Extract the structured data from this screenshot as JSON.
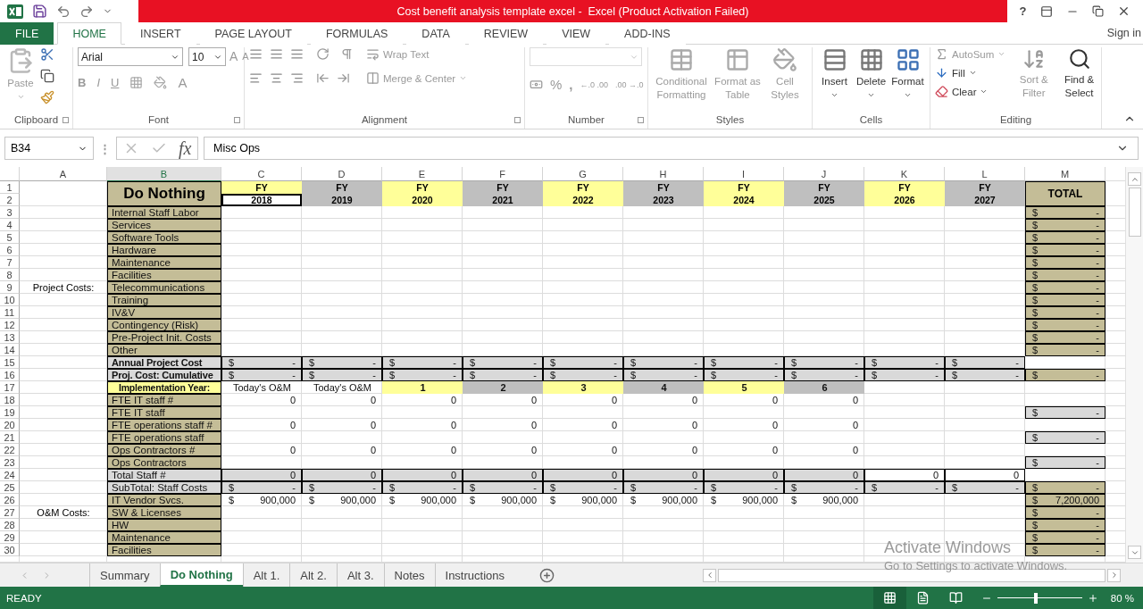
{
  "title_bar": {
    "title": "Cost benefit analysis template excel -  Excel (Product Activation Failed)",
    "help": "?"
  },
  "tabs": [
    {
      "label": "FILE",
      "kind": "file",
      "selected": false
    },
    {
      "label": "HOME",
      "kind": "tab",
      "selected": true
    },
    {
      "label": "INSERT",
      "kind": "tab",
      "selected": false
    },
    {
      "label": "PAGE LAYOUT",
      "kind": "tab",
      "selected": false
    },
    {
      "label": "FORMULAS",
      "kind": "tab",
      "selected": false
    },
    {
      "label": "DATA",
      "kind": "tab",
      "selected": false
    },
    {
      "label": "REVIEW",
      "kind": "tab",
      "selected": false
    },
    {
      "label": "VIEW",
      "kind": "tab",
      "selected": false
    },
    {
      "label": "ADD-INS",
      "kind": "tab",
      "selected": false
    }
  ],
  "sign_in": "Sign in",
  "ribbon": {
    "clipboard": {
      "label": "Clipboard",
      "paste": {
        "label": "Paste",
        "disabled": true
      }
    },
    "font": {
      "label": "Font",
      "font_name": "Arial",
      "font_size": "10",
      "grow": "A",
      "shrink": "A",
      "bold": "B",
      "italic": "I",
      "underline": "U",
      "font_color": "A"
    },
    "alignment": {
      "label": "Alignment",
      "wrap": {
        "label": "Wrap Text",
        "disabled": true
      },
      "merge": {
        "label": "Merge & Center",
        "disabled": true
      }
    },
    "number": {
      "label": "Number",
      "percent": "%",
      "comma": ",",
      "inc_decimal": "←.0 .00",
      "dec_decimal": ".00 →.0"
    },
    "styles": {
      "label": "Styles",
      "items": [
        {
          "label": "Conditional Formatting",
          "disabled": true
        },
        {
          "label": "Format as Table",
          "disabled": true
        },
        {
          "label": "Cell Styles",
          "disabled": true
        }
      ]
    },
    "cells": {
      "label": "Cells",
      "items": [
        {
          "label": "Insert",
          "disabled": false
        },
        {
          "label": "Delete",
          "disabled": false
        },
        {
          "label": "Format",
          "disabled": false
        }
      ]
    },
    "editing": {
      "label": "Editing",
      "autosum": {
        "label": "AutoSum",
        "disabled": true
      },
      "fill": {
        "label": "Fill",
        "disabled": false
      },
      "clear": {
        "label": "Clear",
        "disabled": false
      },
      "sort": {
        "label": "Sort & Filter",
        "disabled": true
      },
      "find": {
        "label": "Find & Select",
        "disabled": false
      }
    }
  },
  "formula_bar": {
    "name_box": "B34",
    "separator": "⋮",
    "fx": "fx",
    "formula": "Misc Ops"
  },
  "columns": [
    {
      "label": "A",
      "selected": false
    },
    {
      "label": "B",
      "selected": true
    },
    {
      "label": "C",
      "selected": false
    },
    {
      "label": "D",
      "selected": false
    },
    {
      "label": "E",
      "selected": false
    },
    {
      "label": "F",
      "selected": false
    },
    {
      "label": "G",
      "selected": false
    },
    {
      "label": "H",
      "selected": false
    },
    {
      "label": "I",
      "selected": false
    },
    {
      "label": "J",
      "selected": false
    },
    {
      "label": "K",
      "selected": false
    },
    {
      "label": "L",
      "selected": false
    },
    {
      "label": "M",
      "selected": false
    }
  ],
  "title_block": {
    "rows": [
      "1",
      "2"
    ],
    "title": "Do Nothing",
    "total": "TOTAL",
    "years": [
      {
        "fy": "FY",
        "year": "2018",
        "color": "#ffff99",
        "outlined": true
      },
      {
        "fy": "FY",
        "year": "2019",
        "color": "#bfbfbf",
        "outlined": false
      },
      {
        "fy": "FY",
        "year": "2020",
        "color": "#ffff99",
        "outlined": false
      },
      {
        "fy": "FY",
        "year": "2021",
        "color": "#bfbfbf",
        "outlined": false
      },
      {
        "fy": "FY",
        "year": "2022",
        "color": "#ffff99",
        "outlined": false
      },
      {
        "fy": "FY",
        "year": "2023",
        "color": "#bfbfbf",
        "outlined": false
      },
      {
        "fy": "FY",
        "year": "2024",
        "color": "#ffff99",
        "outlined": false
      },
      {
        "fy": "FY",
        "year": "2025",
        "color": "#bfbfbf",
        "outlined": false
      },
      {
        "fy": "FY",
        "year": "2026",
        "color": "#ffff99",
        "outlined": false
      },
      {
        "fy": "FY",
        "year": "2027",
        "color": "#bfbfbf",
        "outlined": false
      }
    ]
  },
  "rows": [
    {
      "n": "3",
      "b": "Internal Staff Labor",
      "kind": "tan",
      "cells": [
        null,
        null,
        null,
        null,
        null,
        null,
        null,
        null,
        null,
        null,
        {
          "kind": "tan",
          "cur": "$",
          "val": "-"
        }
      ]
    },
    {
      "n": "4",
      "b": "Services",
      "kind": "tan",
      "cells": [
        null,
        null,
        null,
        null,
        null,
        null,
        null,
        null,
        null,
        null,
        {
          "kind": "tan",
          "cur": "$",
          "val": "-"
        }
      ]
    },
    {
      "n": "5",
      "b": "Software Tools",
      "kind": "tan",
      "cells": [
        null,
        null,
        null,
        null,
        null,
        null,
        null,
        null,
        null,
        null,
        {
          "kind": "tan",
          "cur": "$",
          "val": "-"
        }
      ]
    },
    {
      "n": "6",
      "b": "Hardware",
      "kind": "tan",
      "cells": [
        null,
        null,
        null,
        null,
        null,
        null,
        null,
        null,
        null,
        null,
        {
          "kind": "tan",
          "cur": "$",
          "val": "-"
        }
      ]
    },
    {
      "n": "7",
      "b": "Maintenance",
      "kind": "tan",
      "cells": [
        null,
        null,
        null,
        null,
        null,
        null,
        null,
        null,
        null,
        null,
        {
          "kind": "tan",
          "cur": "$",
          "val": "-"
        }
      ]
    },
    {
      "n": "8",
      "b": "Facilities",
      "kind": "tan",
      "cells": [
        null,
        null,
        null,
        null,
        null,
        null,
        null,
        null,
        null,
        null,
        {
          "kind": "tan",
          "cur": "$",
          "val": "-"
        }
      ]
    },
    {
      "n": "9",
      "a": "Project Costs:",
      "b": "Telecommunications",
      "kind": "tan",
      "cells": [
        null,
        null,
        null,
        null,
        null,
        null,
        null,
        null,
        null,
        null,
        {
          "kind": "tan",
          "cur": "$",
          "val": "-"
        }
      ]
    },
    {
      "n": "10",
      "b": "Training",
      "kind": "tan",
      "cells": [
        null,
        null,
        null,
        null,
        null,
        null,
        null,
        null,
        null,
        null,
        {
          "kind": "tan",
          "cur": "$",
          "val": "-"
        }
      ]
    },
    {
      "n": "11",
      "b": "IV&V",
      "kind": "tan",
      "cells": [
        null,
        null,
        null,
        null,
        null,
        null,
        null,
        null,
        null,
        null,
        {
          "kind": "tan",
          "cur": "$",
          "val": "-"
        }
      ]
    },
    {
      "n": "12",
      "b": "Contingency (Risk)",
      "kind": "tan",
      "cells": [
        null,
        null,
        null,
        null,
        null,
        null,
        null,
        null,
        null,
        null,
        {
          "kind": "tan",
          "cur": "$",
          "val": "-"
        }
      ]
    },
    {
      "n": "13",
      "b": "Pre-Project Init. Costs",
      "kind": "tan",
      "cells": [
        null,
        null,
        null,
        null,
        null,
        null,
        null,
        null,
        null,
        null,
        {
          "kind": "tan",
          "cur": "$",
          "val": "-"
        }
      ]
    },
    {
      "n": "14",
      "b": "Other",
      "kind": "tan",
      "cells": [
        null,
        null,
        null,
        null,
        null,
        null,
        null,
        null,
        null,
        null,
        {
          "kind": "tan",
          "cur": "$",
          "val": "-"
        }
      ]
    },
    {
      "n": "15",
      "b": "Annual Project Cost",
      "kind": "sum",
      "cells": [
        {
          "kind": "grey",
          "cur": "$",
          "val": "-"
        },
        {
          "kind": "grey",
          "cur": "$",
          "val": "-"
        },
        {
          "kind": "grey",
          "cur": "$",
          "val": "-"
        },
        {
          "kind": "grey",
          "cur": "$",
          "val": "-"
        },
        {
          "kind": "grey",
          "cur": "$",
          "val": "-"
        },
        {
          "kind": "grey",
          "cur": "$",
          "val": "-"
        },
        {
          "kind": "grey",
          "cur": "$",
          "val": "-"
        },
        {
          "kind": "grey",
          "cur": "$",
          "val": "-"
        },
        {
          "kind": "grey",
          "cur": "$",
          "val": "-"
        },
        {
          "kind": "grey",
          "cur": "$",
          "val": "-"
        },
        null
      ]
    },
    {
      "n": "16",
      "b": "Proj. Cost: Cumulative",
      "kind": "sum",
      "cells": [
        {
          "kind": "grey",
          "cur": "$",
          "val": "-"
        },
        {
          "kind": "grey",
          "cur": "$",
          "val": "-"
        },
        {
          "kind": "grey",
          "cur": "$",
          "val": "-"
        },
        {
          "kind": "grey",
          "cur": "$",
          "val": "-"
        },
        {
          "kind": "grey",
          "cur": "$",
          "val": "-"
        },
        {
          "kind": "grey",
          "cur": "$",
          "val": "-"
        },
        {
          "kind": "grey",
          "cur": "$",
          "val": "-"
        },
        {
          "kind": "grey",
          "cur": "$",
          "val": "-"
        },
        {
          "kind": "grey",
          "cur": "$",
          "val": "-"
        },
        {
          "kind": "grey",
          "cur": "$",
          "val": "-"
        },
        {
          "kind": "tan",
          "cur": "$",
          "val": "-"
        }
      ]
    },
    {
      "n": "17",
      "b": "Implementation Year:",
      "kind": "impl",
      "cells": [
        {
          "text": "Today's O&M",
          "centered": true
        },
        {
          "text": "Today's O&M",
          "centered": true
        },
        {
          "kind": "yellow",
          "text": "1",
          "centered": true
        },
        {
          "kind": "header",
          "text": "2",
          "centered": true
        },
        {
          "kind": "yellow",
          "text": "3",
          "centered": true
        },
        {
          "kind": "header",
          "text": "4",
          "centered": true
        },
        {
          "kind": "yellow",
          "text": "5",
          "centered": true
        },
        {
          "kind": "header",
          "text": "6",
          "centered": true
        },
        null,
        null,
        null
      ]
    },
    {
      "n": "18",
      "b": "FTE IT staff #",
      "kind": "tan",
      "cells": [
        {
          "text": "0"
        },
        {
          "text": "0"
        },
        {
          "text": "0"
        },
        {
          "text": "0"
        },
        {
          "text": "0"
        },
        {
          "text": "0"
        },
        {
          "text": "0"
        },
        {
          "text": "0"
        },
        null,
        null,
        null
      ]
    },
    {
      "n": "19",
      "b": "FTE IT staff",
      "kind": "tan",
      "cells": [
        null,
        null,
        null,
        null,
        null,
        null,
        null,
        null,
        null,
        null,
        {
          "kind": "grey",
          "cur": "$",
          "val": "-"
        }
      ]
    },
    {
      "n": "20",
      "b": "FTE operations staff #",
      "kind": "tan",
      "cells": [
        {
          "text": "0"
        },
        {
          "text": "0"
        },
        {
          "text": "0"
        },
        {
          "text": "0"
        },
        {
          "text": "0"
        },
        {
          "text": "0"
        },
        {
          "text": "0"
        },
        {
          "text": "0"
        },
        null,
        null,
        null
      ]
    },
    {
      "n": "21",
      "b": "FTE operations staff",
      "kind": "tan",
      "cells": [
        null,
        null,
        null,
        null,
        null,
        null,
        null,
        null,
        null,
        null,
        {
          "kind": "grey",
          "cur": "$",
          "val": "-"
        }
      ]
    },
    {
      "n": "22",
      "b": "Ops Contractors #",
      "kind": "tan",
      "cells": [
        {
          "text": "0"
        },
        {
          "text": "0"
        },
        {
          "text": "0"
        },
        {
          "text": "0"
        },
        {
          "text": "0"
        },
        {
          "text": "0"
        },
        {
          "text": "0"
        },
        {
          "text": "0"
        },
        null,
        null,
        null
      ]
    },
    {
      "n": "23",
      "b": "Ops Contractors",
      "kind": "tan",
      "cells": [
        null,
        null,
        null,
        null,
        null,
        null,
        null,
        null,
        null,
        null,
        {
          "kind": "grey",
          "cur": "$",
          "val": "-"
        }
      ]
    },
    {
      "n": "24",
      "b": "Total Staff #",
      "kind": "grey",
      "cells": [
        {
          "kind": "grey",
          "text": "0"
        },
        {
          "kind": "grey",
          "text": "0"
        },
        {
          "kind": "grey",
          "text": "0"
        },
        {
          "kind": "grey",
          "text": "0"
        },
        {
          "kind": "grey",
          "text": "0"
        },
        {
          "kind": "grey",
          "text": "0"
        },
        {
          "kind": "grey",
          "text": "0"
        },
        {
          "kind": "grey",
          "text": "0"
        },
        {
          "kind": "boxed",
          "text": "0"
        },
        {
          "kind": "boxed",
          "text": "0"
        },
        null
      ]
    },
    {
      "n": "25",
      "b": "SubTotal: Staff Costs",
      "kind": "grey",
      "cells": [
        {
          "kind": "grey",
          "cur": "$",
          "val": "-"
        },
        {
          "kind": "grey",
          "cur": "$",
          "val": "-"
        },
        {
          "kind": "grey",
          "cur": "$",
          "val": "-"
        },
        {
          "kind": "grey",
          "cur": "$",
          "val": "-"
        },
        {
          "kind": "grey",
          "cur": "$",
          "val": "-"
        },
        {
          "kind": "grey",
          "cur": "$",
          "val": "-"
        },
        {
          "kind": "grey",
          "cur": "$",
          "val": "-"
        },
        {
          "kind": "grey",
          "cur": "$",
          "val": "-"
        },
        {
          "kind": "grey",
          "cur": "$",
          "val": "-"
        },
        {
          "kind": "grey",
          "cur": "$",
          "val": "-"
        },
        {
          "kind": "tan",
          "cur": "$",
          "val": "-"
        }
      ]
    },
    {
      "n": "26",
      "b": "IT Vendor Svcs.",
      "kind": "tan",
      "cells": [
        {
          "cur": "$",
          "val": "900,000"
        },
        {
          "cur": "$",
          "val": "900,000"
        },
        {
          "cur": "$",
          "val": "900,000"
        },
        {
          "cur": "$",
          "val": "900,000"
        },
        {
          "cur": "$",
          "val": "900,000"
        },
        {
          "cur": "$",
          "val": "900,000"
        },
        {
          "cur": "$",
          "val": "900,000"
        },
        {
          "cur": "$",
          "val": "900,000"
        },
        null,
        null,
        {
          "kind": "tan",
          "cur": "$",
          "val": "7,200,000"
        }
      ]
    },
    {
      "n": "27",
      "a": "O&M Costs:",
      "b": "SW & Licenses",
      "kind": "tan",
      "cells": [
        null,
        null,
        null,
        null,
        null,
        null,
        null,
        null,
        null,
        null,
        {
          "kind": "tan",
          "cur": "$",
          "val": "-"
        }
      ]
    },
    {
      "n": "28",
      "b": "HW",
      "kind": "tan",
      "cells": [
        null,
        null,
        null,
        null,
        null,
        null,
        null,
        null,
        null,
        null,
        {
          "kind": "tan",
          "cur": "$",
          "val": "-"
        }
      ]
    },
    {
      "n": "29",
      "b": "Maintenance",
      "kind": "tan",
      "cells": [
        null,
        null,
        null,
        null,
        null,
        null,
        null,
        null,
        null,
        null,
        {
          "kind": "tan",
          "cur": "$",
          "val": "-"
        }
      ]
    },
    {
      "n": "30",
      "b": "Facilities",
      "kind": "tan",
      "cells": [
        null,
        null,
        null,
        null,
        null,
        null,
        null,
        null,
        null,
        null,
        {
          "kind": "tan",
          "cur": "$",
          "val": "-"
        }
      ]
    }
  ],
  "sheet_tabs": [
    {
      "label": "Summary",
      "selected": false
    },
    {
      "label": "Do Nothing",
      "selected": true
    },
    {
      "label": "Alt 1.",
      "selected": false
    },
    {
      "label": "Alt 2.",
      "selected": false
    },
    {
      "label": "Alt 3.",
      "selected": false
    },
    {
      "label": "Notes",
      "selected": false
    },
    {
      "label": "Instructions",
      "selected": false
    }
  ],
  "os_notice": {
    "title": "Activate Windows",
    "text": "Go to Settings to activate Windows."
  },
  "status_bar": {
    "mode": "READY",
    "views": [
      {
        "selected": true
      },
      {
        "selected": false
      },
      {
        "selected": false
      }
    ],
    "zoom_slider": {
      "level": 0.45
    },
    "zoom": "80 %"
  }
}
